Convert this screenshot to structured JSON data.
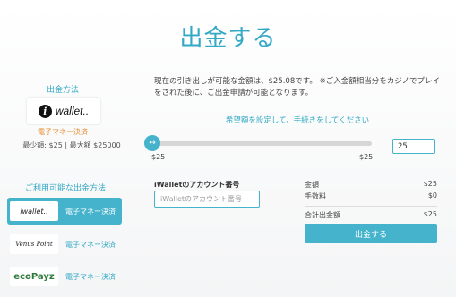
{
  "page": {
    "title": "出金する"
  },
  "left": {
    "method_heading": "出金方法",
    "selected_method": {
      "logo_icon": "iwallet-logo-icon",
      "logo_text": "wallet..",
      "type_label": "電子マネー決済"
    },
    "limits": "最少額: $25 | 最大額 $25000",
    "available_heading": "ご利用可能な出金方法",
    "options": [
      {
        "logo": "iwallet..",
        "label": "電子マネー決済",
        "active": true
      },
      {
        "logo": "Venus Point",
        "label": "電子マネー決済",
        "active": false
      },
      {
        "logo": "ecoPayz",
        "label": "電子マネー決済",
        "active": false
      }
    ]
  },
  "main": {
    "description": "現在の引き出しが可能な金額は、$25.08です。 ※ご入金額相当分をカジノでプレイをされた後に、ご出金申請が可能となります。",
    "slider_caption": "希望額を設定して、手続きをしてください",
    "slider": {
      "min_label": "$25",
      "max_label": "$25",
      "value": 25,
      "handle_icon": "arrows-left-right-icon"
    },
    "amount_value": "25",
    "account_label": "iWalletのアカウント番号",
    "account_placeholder": "iWalletのアカウント番号"
  },
  "summary": {
    "amount_label": "金額",
    "amount_value": "$25",
    "fee_label": "手数料",
    "fee_value": "$0",
    "total_label": "合計出金額",
    "total_value": "$25",
    "button_label": "出金する"
  },
  "colors": {
    "accent": "#45b3cc",
    "title": "#33a9c5",
    "ewallet": "#e58b2e"
  }
}
